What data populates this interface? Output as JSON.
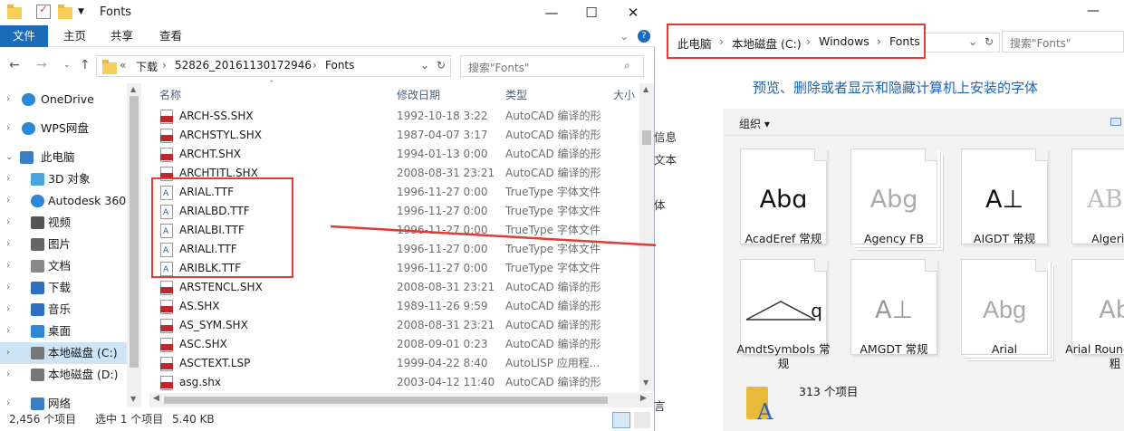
{
  "left": {
    "title": "Fonts",
    "ribbon_tabs": [
      "文件",
      "主页",
      "共享",
      "查看"
    ],
    "address": {
      "prefix": "«",
      "parts": [
        "下载",
        "52826_20161130172946",
        "Fonts"
      ]
    },
    "search_placeholder": "搜索\"Fonts\"",
    "columns": {
      "name": "名称",
      "date": "修改日期",
      "type": "类型",
      "size": "大小"
    },
    "nav": [
      {
        "label": "OneDrive",
        "icon": "cloud-icon"
      },
      {
        "label": "WPS网盘",
        "icon": "cloud-icon"
      },
      {
        "label": "此电脑",
        "icon": "computer-icon"
      },
      {
        "label": "3D 对象",
        "icon": "cube-icon"
      },
      {
        "label": "Autodesk 360",
        "icon": "cloud-icon"
      },
      {
        "label": "视频",
        "icon": "video-icon"
      },
      {
        "label": "图片",
        "icon": "image-icon"
      },
      {
        "label": "文档",
        "icon": "document-icon"
      },
      {
        "label": "下载",
        "icon": "download-icon"
      },
      {
        "label": "音乐",
        "icon": "music-icon"
      },
      {
        "label": "桌面",
        "icon": "desktop-icon"
      },
      {
        "label": "本地磁盘 (C:)",
        "icon": "drive-icon"
      },
      {
        "label": "本地磁盘 (D:)",
        "icon": "drive-icon"
      },
      {
        "label": "网络",
        "icon": "network-icon"
      }
    ],
    "files": [
      {
        "name": "ARCH-SS.SHX",
        "date": "1992-10-18 3:22",
        "type": "AutoCAD 编译的形",
        "kind": "shx"
      },
      {
        "name": "ARCHSTYL.SHX",
        "date": "1987-04-07 3:17",
        "type": "AutoCAD 编译的形",
        "kind": "shx"
      },
      {
        "name": "ARCHT.SHX",
        "date": "1994-01-13 0:00",
        "type": "AutoCAD 编译的形",
        "kind": "shx"
      },
      {
        "name": "ARCHTITL.SHX",
        "date": "2008-08-31 23:21",
        "type": "AutoCAD 编译的形",
        "kind": "shx"
      },
      {
        "name": "ARIAL.TTF",
        "date": "1996-11-27 0:00",
        "type": "TrueType 字体文件",
        "kind": "ttf"
      },
      {
        "name": "ARIALBD.TTF",
        "date": "1996-11-27 0:00",
        "type": "TrueType 字体文件",
        "kind": "ttf"
      },
      {
        "name": "ARIALBI.TTF",
        "date": "1996-11-27 0:00",
        "type": "TrueType 字体文件",
        "kind": "ttf"
      },
      {
        "name": "ARIALI.TTF",
        "date": "1996-11-27 0:00",
        "type": "TrueType 字体文件",
        "kind": "ttf"
      },
      {
        "name": "ARIBLK.TTF",
        "date": "1996-11-27 0:00",
        "type": "TrueType 字体文件",
        "kind": "ttf"
      },
      {
        "name": "ARSTENCL.SHX",
        "date": "2008-08-31 23:21",
        "type": "AutoCAD 编译的形",
        "kind": "shx"
      },
      {
        "name": "AS.SHX",
        "date": "1989-11-26 9:59",
        "type": "AutoCAD 编译的形",
        "kind": "shx"
      },
      {
        "name": "AS_SYM.SHX",
        "date": "2008-08-31 23:21",
        "type": "AutoCAD 编译的形",
        "kind": "shx"
      },
      {
        "name": "ASC.SHX",
        "date": "2008-09-01 0:23",
        "type": "AutoCAD 编译的形",
        "kind": "shx"
      },
      {
        "name": "ASCTEXT.LSP",
        "date": "1999-04-22 8:40",
        "type": "AutoLISP 应用程...",
        "kind": "lsp"
      },
      {
        "name": "asg.shx",
        "date": "2003-04-12 11:40",
        "type": "AutoCAD 编译的形",
        "kind": "shx"
      }
    ],
    "status": {
      "count": "2,456 个项目",
      "selected": "选中 1 个项目",
      "size": "5.40 KB"
    }
  },
  "right": {
    "breadcrumb": [
      "此电脑",
      "本地磁盘 (C:)",
      "Windows",
      "Fonts"
    ],
    "search_placeholder": "搜索\"Fonts\"",
    "heading": "预览、删除或者显示和隐藏计算机上安装的字体",
    "organize": "组织 ▾",
    "side_texts": [
      "信息",
      "文本",
      "体",
      "言"
    ],
    "fonts": [
      {
        "label": "AcadEref 常规",
        "sample": "Abɑ",
        "stack": false
      },
      {
        "label": "Agency FB",
        "sample": "Abg",
        "stack": true
      },
      {
        "label": "AIGDT 常规",
        "sample": "A⊥",
        "stack": false
      },
      {
        "label": "Algerian",
        "sample": "ABG",
        "stack": false
      },
      {
        "label": "AmdtSymbols 常规",
        "sample": "q",
        "stack": false
      },
      {
        "label": "AMGDT 常规",
        "sample": "A⊥",
        "stack": false
      },
      {
        "label": "Arial",
        "sample": "Abg",
        "stack": true
      },
      {
        "label": "Arial Rounded MT 粗",
        "sample": "Ab",
        "stack": false
      }
    ],
    "item_count": "313 个项目"
  }
}
